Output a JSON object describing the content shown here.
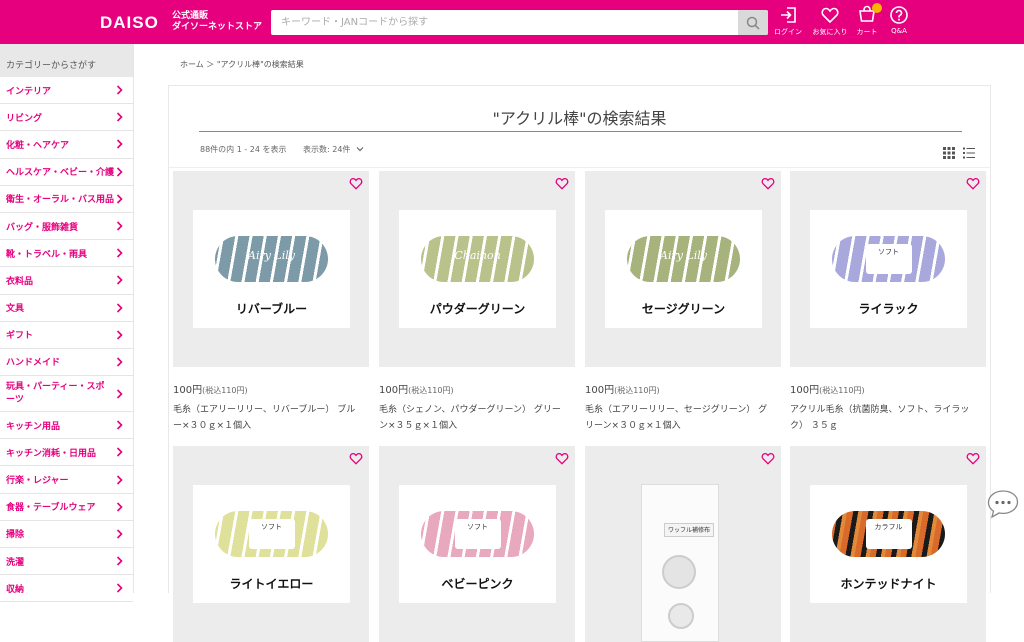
{
  "header": {
    "logo": "DAISO",
    "logo_sub_1": "公式通販",
    "logo_sub_2": "ダイソーネットストア",
    "search_placeholder": "キーワード・JANコードから探す",
    "icons": [
      {
        "icon": "login-icon",
        "label": "ログイン"
      },
      {
        "icon": "heart-icon",
        "label": "お気に入り"
      },
      {
        "icon": "cart-icon",
        "label": "カート"
      },
      {
        "icon": "help-icon",
        "label": "Q&A"
      }
    ],
    "brand_color": "#e6007e"
  },
  "sidebar": {
    "title": "カテゴリーからさがす",
    "items": [
      "インテリア",
      "リビング",
      "化粧・ヘアケア",
      "ヘルスケア・ベビー・介護",
      "衛生・オーラル・バス用品",
      "バッグ・服飾雑貨",
      "靴・トラベル・雨具",
      "衣料品",
      "文具",
      "ギフト",
      "ハンドメイド",
      "玩具・パーティー・スポーツ",
      "キッチン用品",
      "キッチン消耗・日用品",
      "行楽・レジャー",
      "食器・テーブルウェア",
      "掃除",
      "洗濯",
      "収納"
    ]
  },
  "breadcrumb": "ホーム ＞ \"アクリル棒\"の検索結果",
  "results": {
    "title": "\"アクリル棒\"の検索結果",
    "count": "88件の内 1 - 24 を表示",
    "perpage": "表示数: 24件"
  },
  "products": [
    {
      "price": "100円",
      "tax": "(税込110円)",
      "name_1": "毛糸（エアリーリリー、リバーブルー） ブル",
      "name_2": "ー×３０ｇ×１個入",
      "label": "リバーブルー",
      "script": "Airy Lily",
      "color": "#7d9aa8"
    },
    {
      "price": "100円",
      "tax": "(税込110円)",
      "name_1": "毛糸（シェノン、パウダーグリーン） グリー",
      "name_2": "ン×３５ｇ×１個入",
      "label": "パウダーグリーン",
      "script": "Chainon",
      "color": "#b9c28a"
    },
    {
      "price": "100円",
      "tax": "(税込110円)",
      "name_1": "毛糸（エアリーリリー、セージグリーン） グ",
      "name_2": "リーン×３０ｇ×１個入",
      "label": "セージグリーン",
      "script": "Airy Lily",
      "color": "#a6b37d"
    },
    {
      "price": "100円",
      "tax": "(税込110円)",
      "name_1": "アクリル毛糸（抗菌防臭、ソフト、ライラッ",
      "name_2": "ク） ３５ｇ",
      "label": "ライラック",
      "script": "ソフト",
      "color": "#a9a8dd"
    },
    {
      "label": "ライトイエロー",
      "script": "ソフト",
      "color": "#dfe09a"
    },
    {
      "label": "ベビーピンク",
      "script": "ソフト",
      "color": "#e8a8bd"
    },
    {
      "label": "",
      "script": "ワッフル補修布",
      "color": "#f4f4f4"
    },
    {
      "label": "ホンテッドナイト",
      "script": "カラフル",
      "color": "#d96a2a"
    }
  ]
}
